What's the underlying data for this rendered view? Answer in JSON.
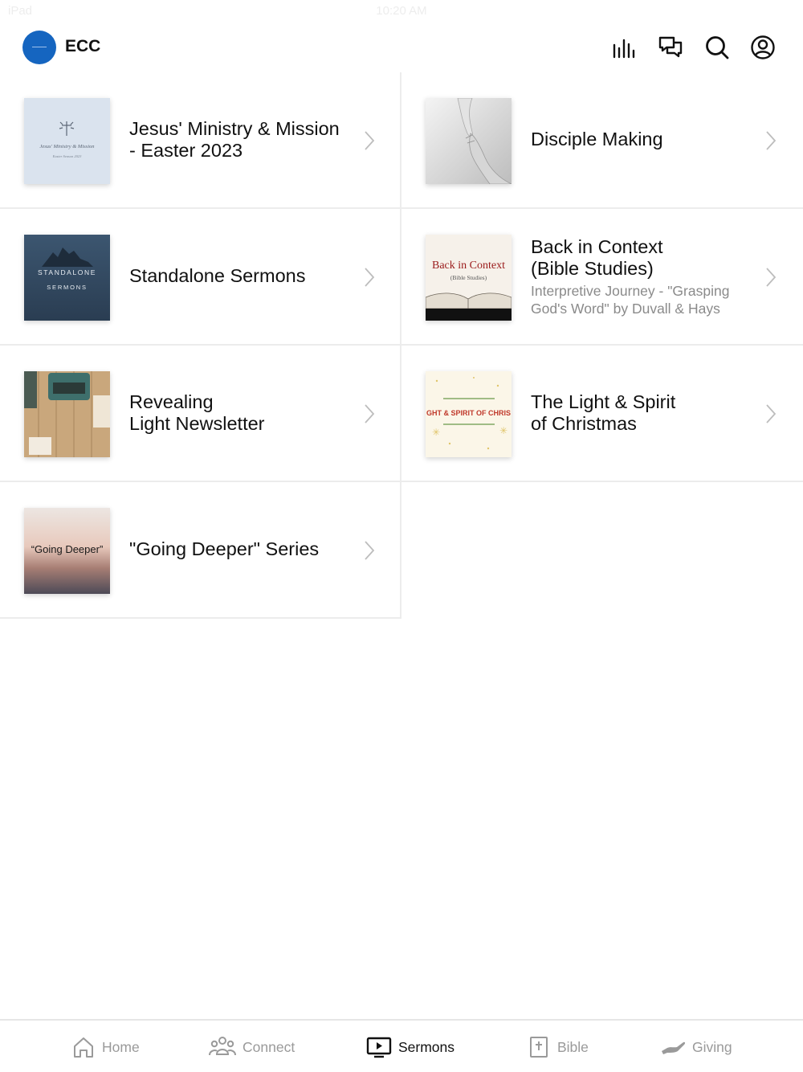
{
  "status_bar": {
    "left_text": "iPad",
    "time": "10:20 AM"
  },
  "header": {
    "app_name": "ECC",
    "icons": [
      "media-bars-icon",
      "chat-icon",
      "search-icon",
      "account-icon"
    ]
  },
  "items": [
    {
      "title": "Jesus' Ministry & Mission\n- Easter 2023",
      "subtitle": "",
      "thumb_icon": "cross-artwork",
      "thumb_text": [
        "Jesus' Ministry & Mission",
        "Easter Season 2023"
      ]
    },
    {
      "title": "Disciple Making",
      "subtitle": "",
      "thumb_icon": "hands-photo",
      "thumb_text": []
    },
    {
      "title": "Standalone Sermons",
      "subtitle": "",
      "thumb_icon": "sea-rock-photo",
      "thumb_text": [
        "STANDALONE",
        "SERMONS"
      ]
    },
    {
      "title": "Back in Context\n(Bible Studies)",
      "subtitle": "Interpretive Journey - \"Grasping\nGod's Word\" by Duvall & Hays",
      "thumb_icon": "open-bible-photo",
      "thumb_text": [
        "Back in Context",
        "(Bible Studies)"
      ]
    },
    {
      "title": "Revealing\nLight Newsletter",
      "subtitle": "",
      "thumb_icon": "typewriter-photo",
      "thumb_text": []
    },
    {
      "title": "The Light & Spirit\nof Christmas",
      "subtitle": "",
      "thumb_icon": "christmas-artwork",
      "thumb_text": [
        "GHT & SPIRIT OF CHRIS"
      ]
    },
    {
      "title": "\"Going Deeper\" Series",
      "subtitle": "",
      "thumb_icon": "sunset-photo",
      "thumb_text": [
        "“Going Deeper”"
      ]
    }
  ],
  "tabs": [
    {
      "label": "Home",
      "icon": "home-icon",
      "active": false
    },
    {
      "label": "Connect",
      "icon": "people-icon",
      "active": false
    },
    {
      "label": "Sermons",
      "icon": "tv-play-icon",
      "active": true
    },
    {
      "label": "Bible",
      "icon": "bible-icon",
      "active": false
    },
    {
      "label": "Giving",
      "icon": "giving-hand-icon",
      "active": false
    }
  ],
  "colors": {
    "brand": "#1565c0",
    "divider": "#ececec",
    "muted_text": "#8a8a8a",
    "inactive_tab": "#9a9a9a"
  }
}
